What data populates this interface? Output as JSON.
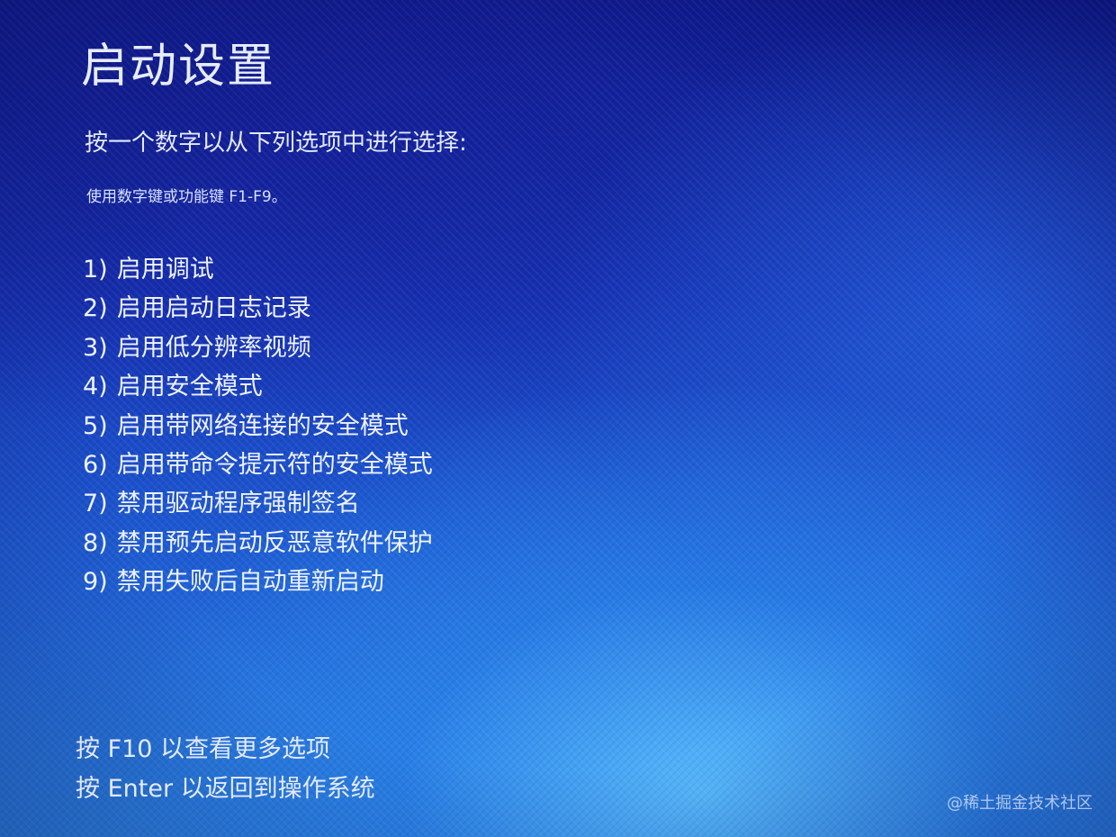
{
  "title": "启动设置",
  "prompt": "按一个数字以从下列选项中进行选择:",
  "hint": "使用数字键或功能键 F1-F9。",
  "options": [
    {
      "number": "1)",
      "label": "启用调试"
    },
    {
      "number": "2)",
      "label": "启用启动日志记录"
    },
    {
      "number": "3)",
      "label": "启用低分辨率视频"
    },
    {
      "number": "4)",
      "label": "启用安全模式"
    },
    {
      "number": "5)",
      "label": "启用带网络连接的安全模式"
    },
    {
      "number": "6)",
      "label": "启用带命令提示符的安全模式"
    },
    {
      "number": "7)",
      "label": "禁用驱动程序强制签名"
    },
    {
      "number": "8)",
      "label": "禁用预先启动反恶意软件保护"
    },
    {
      "number": "9)",
      "label": "禁用失败后自动重新启动"
    }
  ],
  "footer": {
    "more_options": "按 F10 以查看更多选项",
    "return": "按 Enter 以返回到操作系统"
  },
  "watermark": "@稀土掘金技术社区",
  "colors": {
    "background_top": "#0d1a8f",
    "background_bottom": "#2b86e4",
    "text": "#eef2ff"
  }
}
